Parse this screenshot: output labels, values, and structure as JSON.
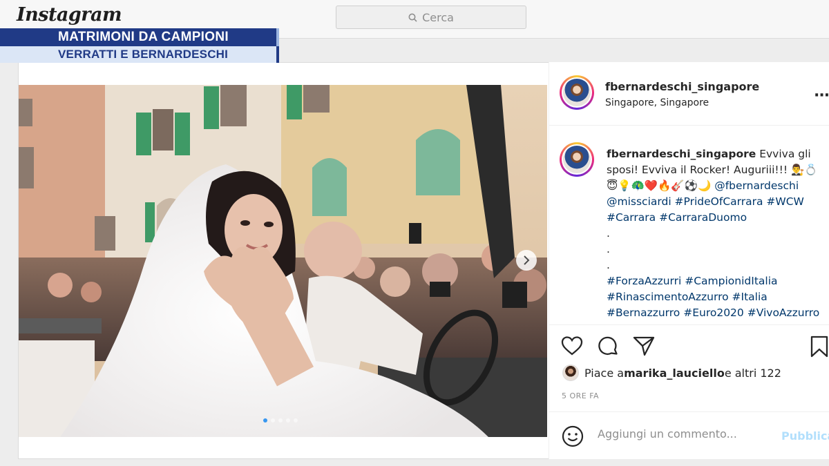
{
  "app": {
    "logo": "Instagram"
  },
  "search": {
    "placeholder": "Cerca"
  },
  "banner": {
    "title": "MATRIMONI DA CAMPIONI",
    "subtitle": "VERRATTI E BERNARDESCHI"
  },
  "post": {
    "username": "fbernardeschi_singapore",
    "location": "Singapore, Singapore",
    "caption": {
      "user": "fbernardeschi_singapore",
      "line1_text": " Evviva gli",
      "line2_text": "sposi! Evviva il Rocker! Auguriii!!! 👨‍⚖️💍",
      "line3_emojis": "😇💡🦚❤️🔥🎸⚽🌙 ",
      "line3_tag": "@fbernardeschi",
      "line4": "@missciardi #PrideOfCarrara #WCW",
      "line5": "#Carrara #CarraraDuomo",
      "dot1": ".",
      "dot2": ".",
      "dot3": ".",
      "line6": "#ForzaAzzurri #CampionidItalia",
      "line7": "#RinascimentoAzzurro #Italia",
      "line8": "#Bernazzurro #Euro2020 #VivoAzzurro"
    },
    "likes": {
      "prefix": "Piace a ",
      "user": "marika_lauciello",
      "suffix": " e altri 122"
    },
    "time": "5 ORE FA",
    "comment": {
      "placeholder": "Aggiungi un commento...",
      "publish": "Pubblica"
    },
    "carousel": {
      "slides": 5,
      "active": 1
    }
  },
  "icons": [
    "search-icon",
    "more-options-icon",
    "heart-icon",
    "comment-icon",
    "share-icon",
    "save-icon",
    "emoji-icon",
    "next-arrow-icon"
  ],
  "colors": {
    "banner_blue": "#203a86",
    "banner_light": "#dbe6f6",
    "link": "#00376b",
    "publish": "#b2dffc"
  }
}
